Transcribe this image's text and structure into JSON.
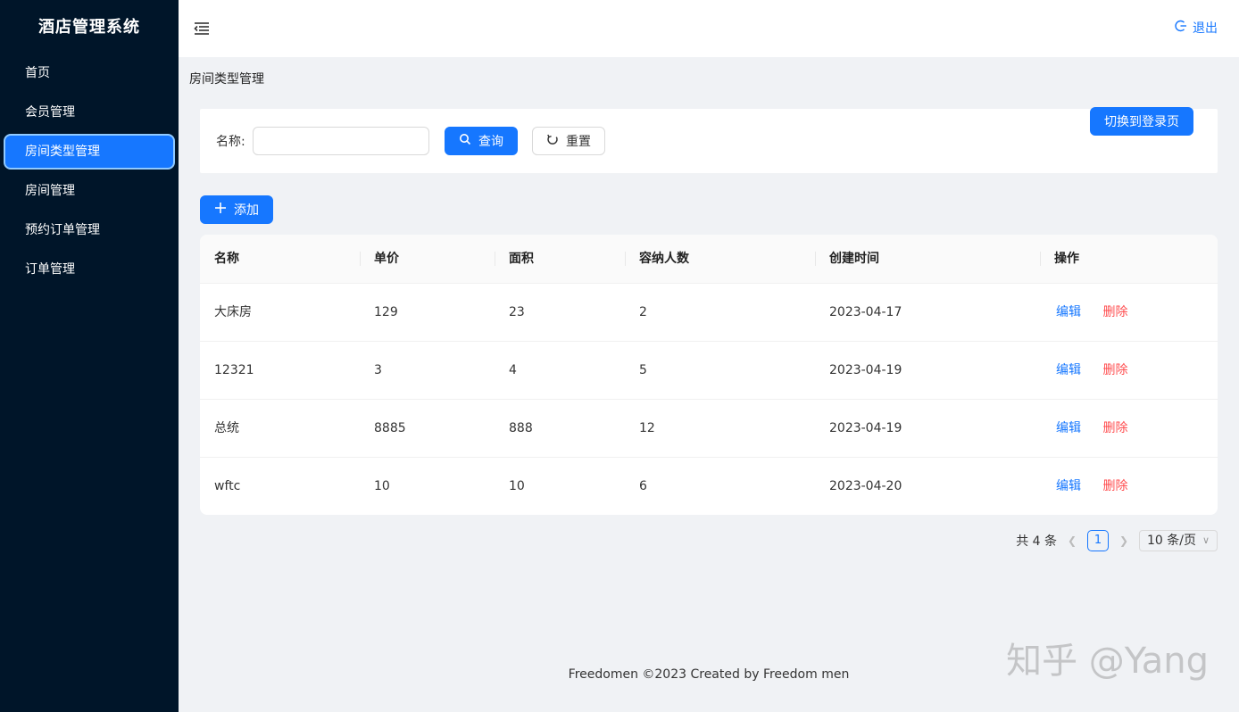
{
  "app": {
    "title": "酒店管理系统"
  },
  "sidebar": {
    "items": [
      {
        "label": "首页",
        "active": false
      },
      {
        "label": "会员管理",
        "active": false
      },
      {
        "label": "房间类型管理",
        "active": true
      },
      {
        "label": "房间管理",
        "active": false
      },
      {
        "label": "预约订单管理",
        "active": false
      },
      {
        "label": "订单管理",
        "active": false
      }
    ]
  },
  "header": {
    "logout_label": "退出",
    "logout_icon": "logout-icon",
    "fold_icon": "menu-fold-icon"
  },
  "breadcrumb": {
    "current": "房间类型管理"
  },
  "search": {
    "name_label": "名称:",
    "name_value": "",
    "name_placeholder": "",
    "query_label": "查询",
    "reset_label": "重置",
    "switch_label": "切换到登录页"
  },
  "toolbar": {
    "add_label": "添加"
  },
  "table": {
    "columns": [
      "名称",
      "单价",
      "面积",
      "容纳人数",
      "创建时间",
      "操作"
    ],
    "rows": [
      {
        "name": "大床房",
        "price": "129",
        "area": "23",
        "capacity": "2",
        "created": "2023-04-17",
        "edit": "编辑",
        "delete": "删除"
      },
      {
        "name": "12321",
        "price": "3",
        "area": "4",
        "capacity": "5",
        "created": "2023-04-19",
        "edit": "编辑",
        "delete": "删除"
      },
      {
        "name": "总统",
        "price": "8885",
        "area": "888",
        "capacity": "12",
        "created": "2023-04-19",
        "edit": "编辑",
        "delete": "删除"
      },
      {
        "name": "wftc",
        "price": "10",
        "area": "10",
        "capacity": "6",
        "created": "2023-04-20",
        "edit": "编辑",
        "delete": "删除"
      }
    ]
  },
  "pagination": {
    "total_text": "共 4 条",
    "current_page": "1",
    "page_size": "10 条/页"
  },
  "footer": {
    "text": "Freedomen ©2023 Created by Freedom men"
  },
  "watermark": {
    "text": "知乎 @Yang"
  },
  "colors": {
    "sider": "#001529",
    "primary": "#1677ff",
    "danger": "#ff4d4f",
    "bg": "#f0f2f5"
  }
}
